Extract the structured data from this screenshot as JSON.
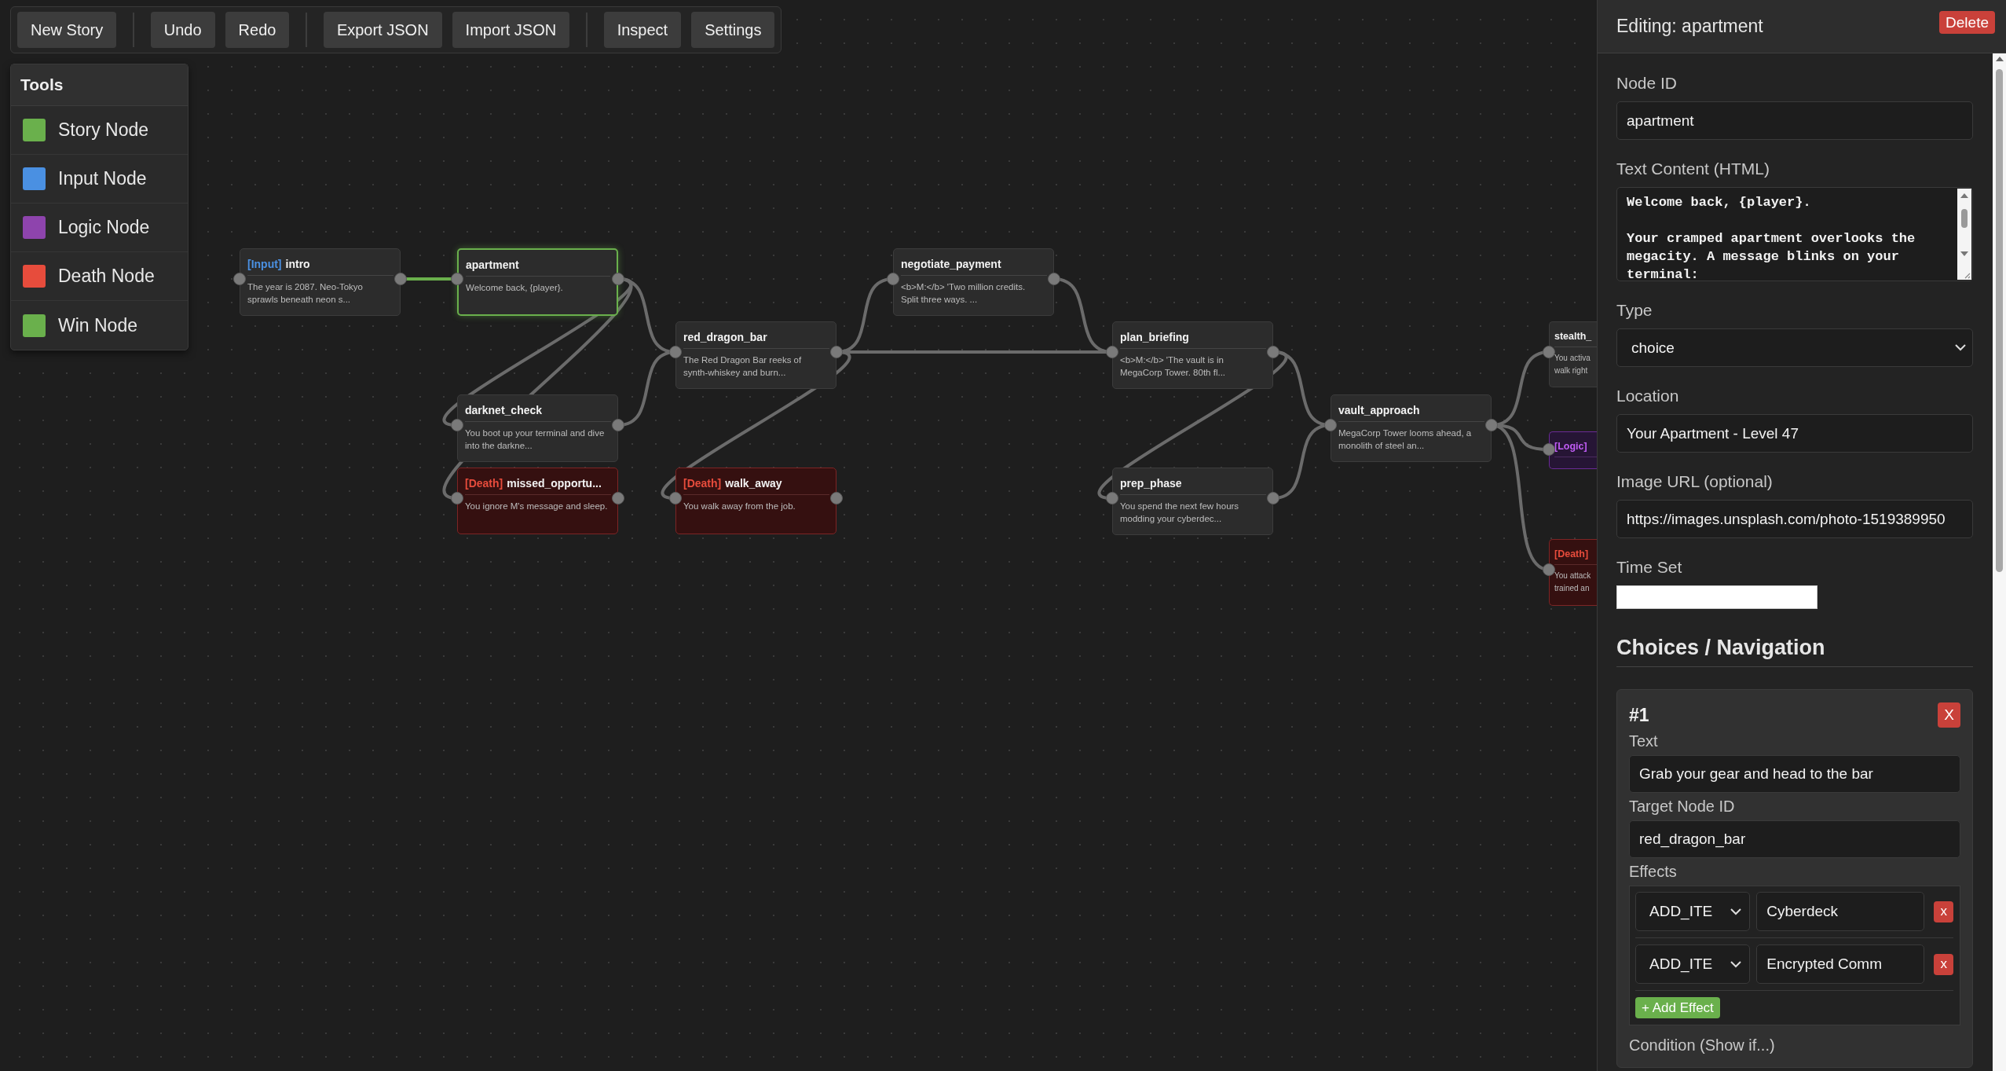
{
  "toolbar": [
    {
      "buttons": [
        "New Story"
      ]
    },
    {
      "buttons": [
        "Undo",
        "Redo"
      ]
    },
    {
      "buttons": [
        "Export JSON",
        "Import JSON"
      ]
    },
    {
      "buttons": [
        "Inspect",
        "Settings"
      ]
    }
  ],
  "tools": {
    "title": "Tools",
    "items": [
      {
        "label": "Story Node",
        "color": "#6ab04c"
      },
      {
        "label": "Input Node",
        "color": "#4a90e2"
      },
      {
        "label": "Logic Node",
        "color": "#8e44ad"
      },
      {
        "label": "Death Node",
        "color": "#e74c3c"
      },
      {
        "label": "Win Node",
        "color": "#6ab04c"
      }
    ]
  },
  "nodes": [
    {
      "kind": "input",
      "label": "[Input]",
      "title": "intro",
      "text": "The year is 2087. Neo-Tokyo\nsprawls beneath neon s...",
      "selected": false
    },
    {
      "kind": "story",
      "title": "apartment",
      "text": "Welcome back, {player}.",
      "selected": true
    },
    {
      "kind": "story",
      "title": "red_dragon_bar",
      "text": "The Red Dragon Bar reeks of\nsynth-whiskey and burn...",
      "selected": false
    },
    {
      "kind": "story",
      "title": "darknet_check",
      "text": "You boot up your terminal and dive\ninto the darkne...",
      "selected": false
    },
    {
      "kind": "death",
      "label": "[Death]",
      "title": "missed_opportu...",
      "text": "You ignore M's message and sleep.",
      "selected": false
    },
    {
      "kind": "death",
      "label": "[Death]",
      "title": "walk_away",
      "text": "You walk away from the job.",
      "selected": false
    },
    {
      "kind": "story",
      "title": "negotiate_payment",
      "text": "<b>M:</b> 'Two million credits.\nSplit three ways. ...",
      "selected": false
    },
    {
      "kind": "story",
      "title": "plan_briefing",
      "text": "<b>M:</b> 'The vault is in\nMegaCorp Tower. 80th fl...",
      "selected": false
    },
    {
      "kind": "story",
      "title": "prep_phase",
      "text": "You spend the next few hours\nmodding your cyberdec...",
      "selected": false
    },
    {
      "kind": "story",
      "title": "vault_approach",
      "text": "MegaCorp Tower looms ahead, a\nmonolith of steel an...",
      "selected": false
    },
    {
      "kind": "story",
      "title": "stealth_",
      "text": "You activa\nwalk right",
      "selected": false
    },
    {
      "kind": "logic",
      "label": "[Logic]",
      "selected": false
    },
    {
      "kind": "death",
      "label": "[Death]",
      "text": "You attack\ntrained an",
      "selected": false
    }
  ],
  "editor": {
    "title": "Editing: apartment",
    "delete": "Delete",
    "fields": [
      {
        "kind": "text",
        "label": "Node ID",
        "value": "apartment"
      },
      {
        "kind": "textarea",
        "label": "Text Content (HTML)",
        "value": "Welcome back, {player}.\n\nYour cramped apartment overlooks the megacity. A message blinks on your terminal:"
      },
      {
        "kind": "select",
        "label": "Type",
        "value": "choice"
      },
      {
        "kind": "text",
        "label": "Location",
        "value": "Your Apartment - Level 47"
      },
      {
        "kind": "text",
        "label": "Image URL (optional)",
        "value": "https://images.unsplash.com/photo-1519389950"
      },
      {
        "kind": "time",
        "label": "Time Set"
      }
    ],
    "choices_heading": "Choices / Navigation",
    "choices": [
      {
        "number": "#1",
        "remove": "X",
        "text_label": "Text",
        "text": "Grab your gear and head to the bar",
        "target_label": "Target Node ID",
        "target": "red_dragon_bar",
        "effects_label": "Effects",
        "effects": [
          {
            "type": "ADD_ITE",
            "value": "Cyberdeck",
            "remove": "x"
          },
          {
            "type": "ADD_ITE",
            "value": "Encrypted Comm",
            "remove": "x"
          }
        ],
        "add_effect": "+ Add Effect",
        "condition_label": "Condition (Show if...)"
      }
    ]
  }
}
